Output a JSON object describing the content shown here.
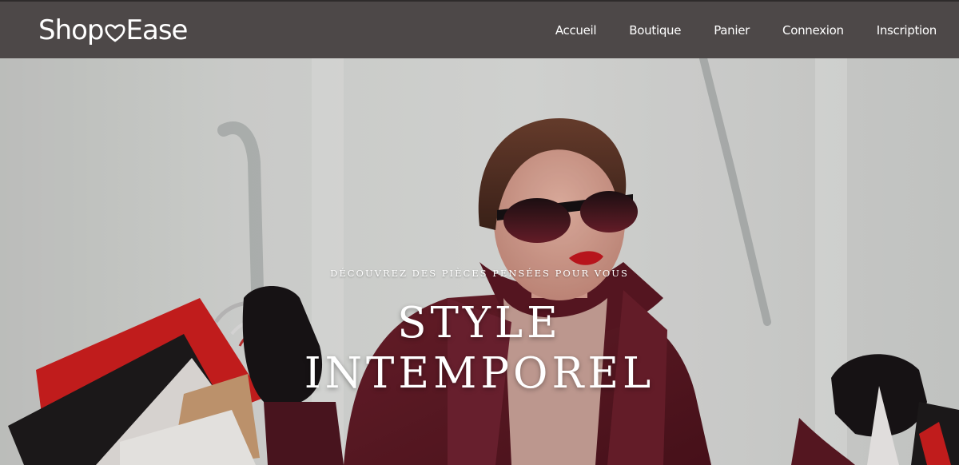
{
  "brand": {
    "name_part1": "Shop",
    "name_part2": "Ease",
    "heart_icon": "heart-icon"
  },
  "nav": {
    "items": [
      {
        "label": "Accueil"
      },
      {
        "label": "Boutique"
      },
      {
        "label": "Panier"
      },
      {
        "label": "Connexion"
      },
      {
        "label": "Inscription"
      }
    ]
  },
  "hero": {
    "kicker": "DÉCOUVREZ DES PIÈCES PENSÉES POUR VOUS",
    "headline_line1": "STYLE",
    "headline_line2": "INTEMPOREL",
    "image_subject": "woman-with-shopping-bags-photo"
  },
  "colors": {
    "navbar": "#4d4848",
    "text": "#ffffff",
    "coat": "#5e1b26",
    "lips": "#c5161e",
    "bag_red": "#d01d1d"
  }
}
